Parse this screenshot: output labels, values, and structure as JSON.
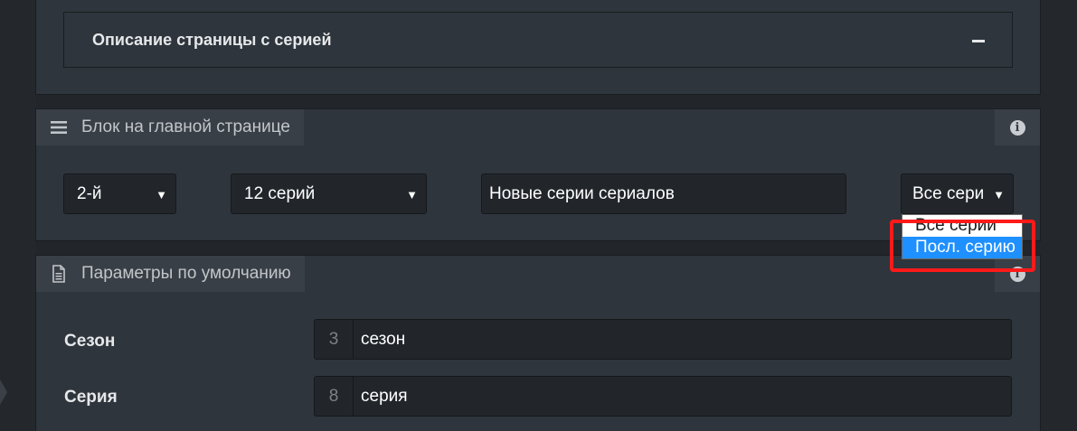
{
  "description_section": {
    "title": "Описание страницы с серией",
    "collapse_symbol": "−"
  },
  "main_page_block": {
    "title": "Блок на главной странице",
    "icon": "menu-icon",
    "info_icon": "info-icon",
    "position_select": {
      "value": "2-й"
    },
    "count_select": {
      "value": "12 серий"
    },
    "title_input": {
      "value": "Новые серии сериалов"
    },
    "mode_select": {
      "value": "Все сери",
      "options": [
        "Все серии",
        "Посл. серию"
      ],
      "highlighted_option": "Посл. серию"
    }
  },
  "default_params": {
    "title": "Параметры по умолчанию",
    "icon": "document-icon",
    "info_icon": "info-icon",
    "rows": [
      {
        "label": "Сезон",
        "number": "3",
        "text": "сезон"
      },
      {
        "label": "Серия",
        "number": "8",
        "text": "серия"
      }
    ]
  },
  "colors": {
    "background": "#22262b",
    "panel": "#2e353c",
    "tab": "#393f46",
    "highlight": "#1e90ff",
    "annotation": "#ff1a1a"
  }
}
